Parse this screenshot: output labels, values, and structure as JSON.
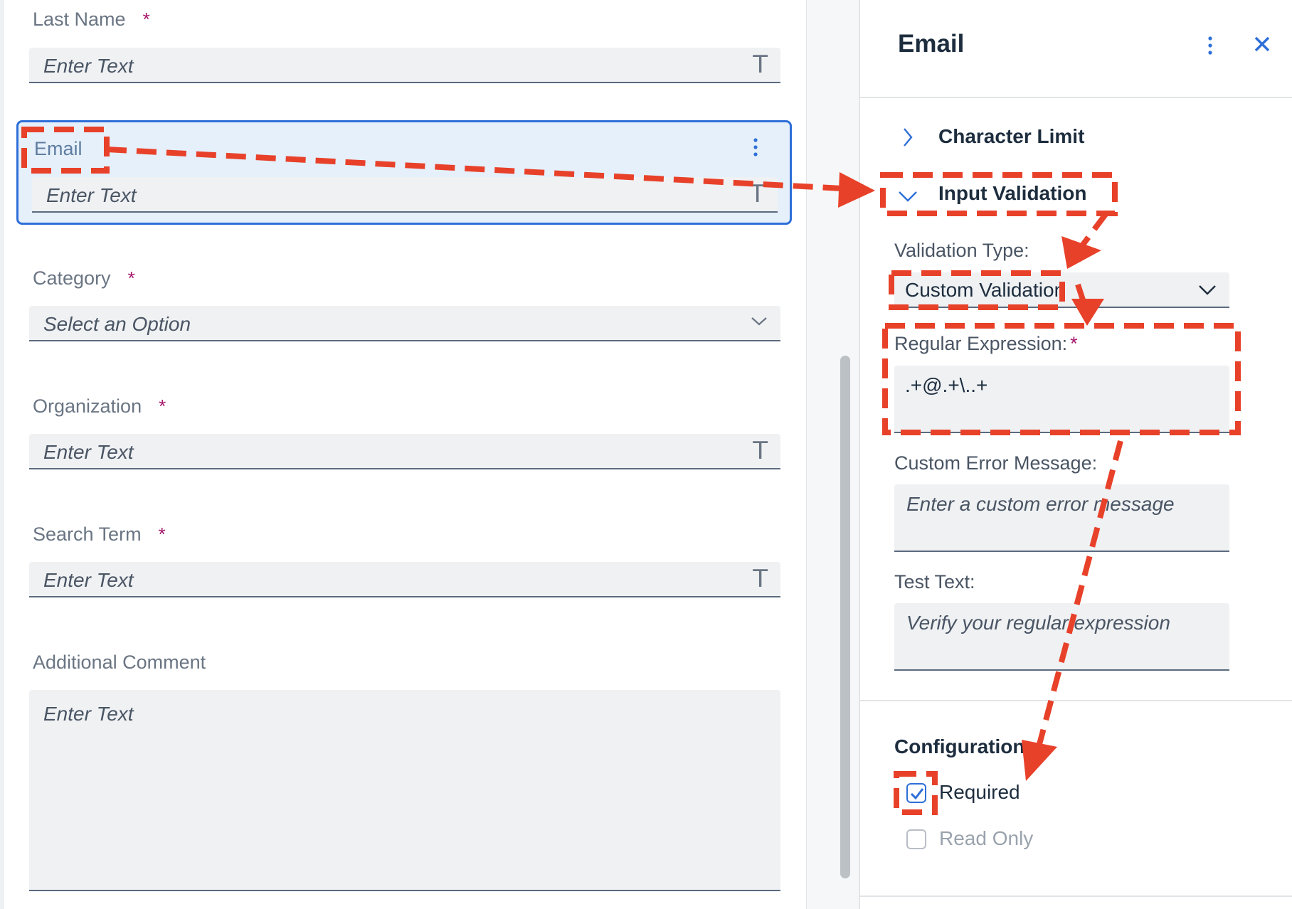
{
  "form": {
    "last_name": {
      "label": "Last Name",
      "required_mark": "*",
      "placeholder": "Enter Text"
    },
    "email": {
      "label": "Email",
      "placeholder": "Enter Text"
    },
    "category": {
      "label": "Category",
      "required_mark": "*",
      "placeholder": "Select an Option"
    },
    "organization": {
      "label": "Organization",
      "required_mark": "*",
      "placeholder": "Enter Text"
    },
    "search_term": {
      "label": "Search Term",
      "required_mark": "*",
      "placeholder": "Enter Text"
    },
    "additional_comment": {
      "label": "Additional Comment",
      "placeholder": "Enter Text"
    },
    "text_icon_glyph": "T"
  },
  "panel": {
    "title": "Email",
    "character_limit_label": "Character Limit",
    "input_validation_label": "Input Validation",
    "validation_type_label": "Validation Type:",
    "validation_type_value": "Custom Validation",
    "regex_label": "Regular Expression:",
    "regex_required_mark": "*",
    "regex_value": ".+@.+\\..+",
    "custom_error_label": "Custom Error Message:",
    "custom_error_placeholder": "Enter a custom error message",
    "test_text_label": "Test Text:",
    "test_text_placeholder": "Verify your regular expression",
    "configuration_label": "Configuration",
    "required_label": "Required",
    "read_only_label": "Read Only",
    "required_checked": true,
    "read_only_checked": false
  },
  "colors": {
    "accent": "#2f6fd8",
    "annotation": "#e8412a",
    "required_mark": "#a5176b"
  }
}
